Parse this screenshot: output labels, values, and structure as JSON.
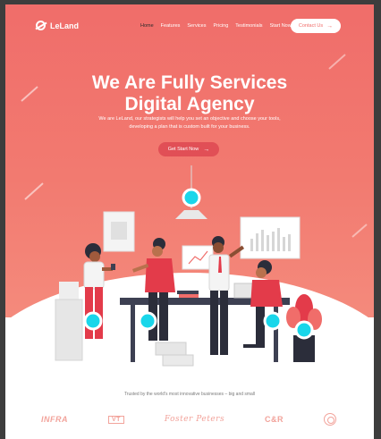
{
  "brand": {
    "name": "LeLand"
  },
  "nav": {
    "items": [
      "Home",
      "Features",
      "Services",
      "Pricing",
      "Testimonials",
      "Start Now"
    ],
    "active": "Home",
    "contact_label": "Contact Us"
  },
  "hero": {
    "title_line1": "We Are Fully Services",
    "title_line2": "Digital Agency",
    "subtitle_line1": "We are LeLand, our strategists will help you set an objective and choose your tools,",
    "subtitle_line2": "developing a plan that is custom built for your business.",
    "cta_label": "Get Start Now"
  },
  "trusted": {
    "text": "Trusted by the world's most innovative businesses – big and small",
    "logos": [
      "INFRA",
      "VT",
      "Foster Peters",
      "C&R",
      "circle-logo"
    ]
  },
  "colors": {
    "accent": "#f06d6a",
    "cta": "#e14f56",
    "marker": "#19d6ea",
    "logo_tint": "#f2a39b"
  },
  "icons": {
    "arrow": "→"
  }
}
